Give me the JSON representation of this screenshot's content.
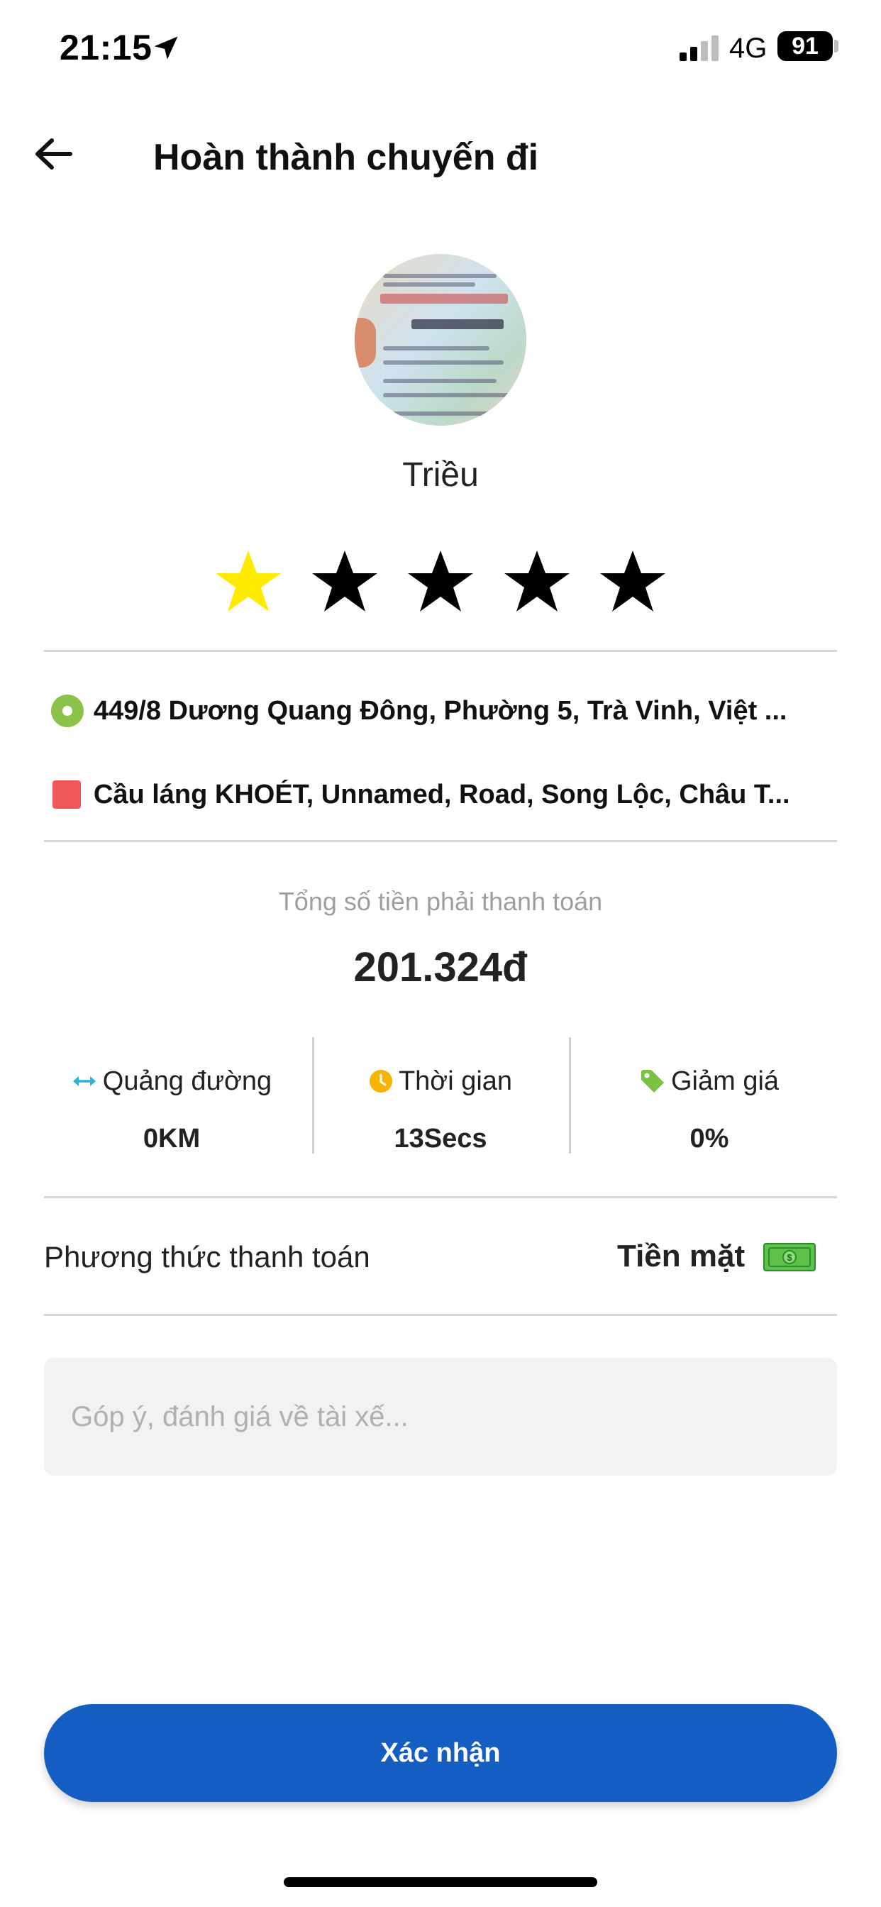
{
  "status_bar": {
    "time": "21:15",
    "network": "4G",
    "battery": "91",
    "icons": [
      "location-arrow-icon",
      "signal-icon",
      "battery-icon"
    ]
  },
  "header": {
    "title": "Hoàn thành chuyến đi",
    "back_icon": "arrow-left-icon"
  },
  "driver": {
    "name": "Triều",
    "avatar": "id-card-photo",
    "rating": {
      "selected": 1,
      "max": 5,
      "selected_color": "#FFEB00",
      "unselected_color": "#000000"
    }
  },
  "route": {
    "pickup": "449/8 Dương Quang Đông, Phường 5, Trà Vinh, Việt ...",
    "dropoff": "Cầu láng KHOÉT, Unnamed, Road, Song Lộc, Châu T...",
    "pickup_color": "#8BC34A",
    "dropoff_color": "#F25757"
  },
  "payment": {
    "total_label": "Tổng số tiền phải thanh toán",
    "total_amount": "201.324đ",
    "stats": [
      {
        "icon": "distance-arrows-icon",
        "label": "Quảng đường",
        "value": "0KM"
      },
      {
        "icon": "clock-icon",
        "label": "Thời gian",
        "value": "13Secs"
      },
      {
        "icon": "tag-icon",
        "label": "Giảm giá",
        "value": "0%"
      }
    ],
    "method_label": "Phương thức thanh toán",
    "method_value": "Tiền mặt",
    "method_icon": "cash-icon"
  },
  "feedback": {
    "placeholder": "Góp ý, đánh giá về tài xế...",
    "value": ""
  },
  "confirm": {
    "label": "Xác nhận",
    "color": "#145EC3"
  }
}
